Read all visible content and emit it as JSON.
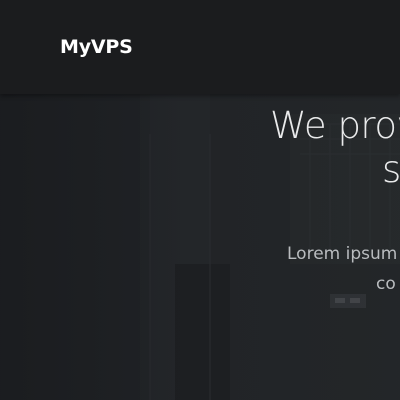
{
  "navbar": {
    "brand": "MyVPS"
  },
  "hero": {
    "headline_line1": "We prov",
    "headline_line2": "s",
    "subtext_line1": "Lorem ipsum d",
    "subtext_line2": "co"
  },
  "colors": {
    "navbar_bg": "#1b1c1e",
    "hero_bg": "#26292c",
    "brand_text": "#ffffff",
    "headline_text": "#e9eaeb",
    "subtext": "#b9bcbf"
  }
}
